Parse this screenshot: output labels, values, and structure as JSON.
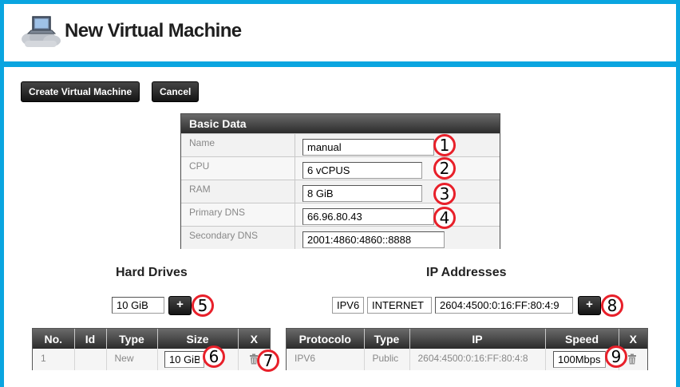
{
  "header": {
    "title": "New Virtual Machine",
    "logo_icon": "cloud-computer-icon"
  },
  "toolbar": {
    "create_label": "Create Virtual Machine",
    "cancel_label": "Cancel"
  },
  "basic_data": {
    "title": "Basic Data",
    "fields": [
      {
        "label": "Name",
        "value": "manual",
        "badge": "1"
      },
      {
        "label": "CPU",
        "value": "6 vCPUS",
        "badge": "2"
      },
      {
        "label": "RAM",
        "value": "8 GiB",
        "badge": "3"
      },
      {
        "label": "Primary DNS",
        "value": "66.96.80.43",
        "badge": "4"
      },
      {
        "label": "Secondary DNS",
        "value": "2001:4860:4860::8888"
      }
    ]
  },
  "hard_drives": {
    "title": "Hard Drives",
    "size_input": "10 GiB",
    "add_label": "+",
    "add_badge": "5",
    "columns": [
      "No.",
      "Id",
      "Type",
      "Size",
      "X"
    ],
    "rows": [
      {
        "no": "1",
        "id": "",
        "type": "New",
        "size": "10 GiB",
        "size_badge": "6",
        "delete_badge": "7"
      }
    ]
  },
  "ip_addresses": {
    "title": "IP Addresses",
    "protocol_select": "IPV6",
    "type_select": "INTERNET",
    "address_input": "2604:4500:0:16:FF:80:4:9",
    "add_label": "+",
    "add_badge": "8",
    "columns": [
      "Protocolo",
      "Type",
      "IP",
      "Speed",
      "X"
    ],
    "rows": [
      {
        "protocol": "IPV6",
        "type": "Public",
        "ip": "2604:4500:0:16:FF:80:4:8",
        "speed": "100Mbps",
        "speed_badge": "9"
      }
    ]
  },
  "colors": {
    "frame": "#0aa5e0",
    "badge_ring": "#e8202a",
    "header_dark": "#2b2b2b"
  }
}
